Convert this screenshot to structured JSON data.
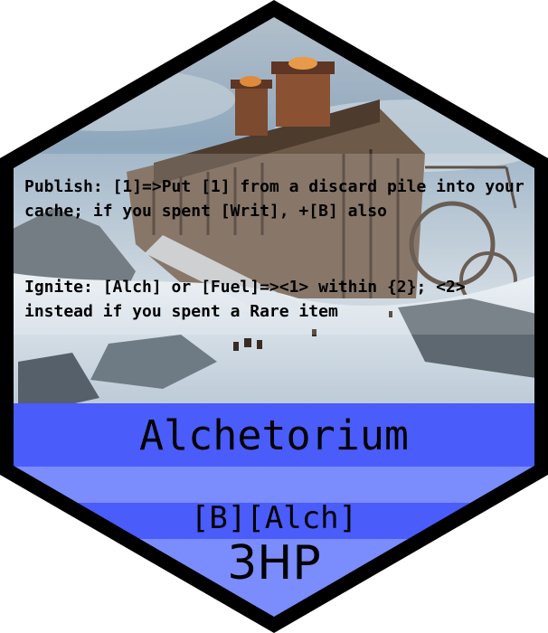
{
  "card": {
    "name": "Alchetorium",
    "abilities": [
      "Publish: [1]=>Put [1] from a discard pile into your cache; if you spent [Writ], +[B] also",
      "Ignite: [Alch] or [Fuel]=><1> within {2}; <2> instead if you spent a Rare item"
    ],
    "cost": "[B][Alch]",
    "hp": "3HP"
  },
  "colors": {
    "border": "#000000",
    "title_band": "#4a5cfa",
    "light_band": "#7b8cfd",
    "artwork_sky": "#9fb3c6",
    "snow": "#dce4ec",
    "fortress": "#6c5848"
  },
  "artwork": "snowy-industrial-fortress-artwork"
}
